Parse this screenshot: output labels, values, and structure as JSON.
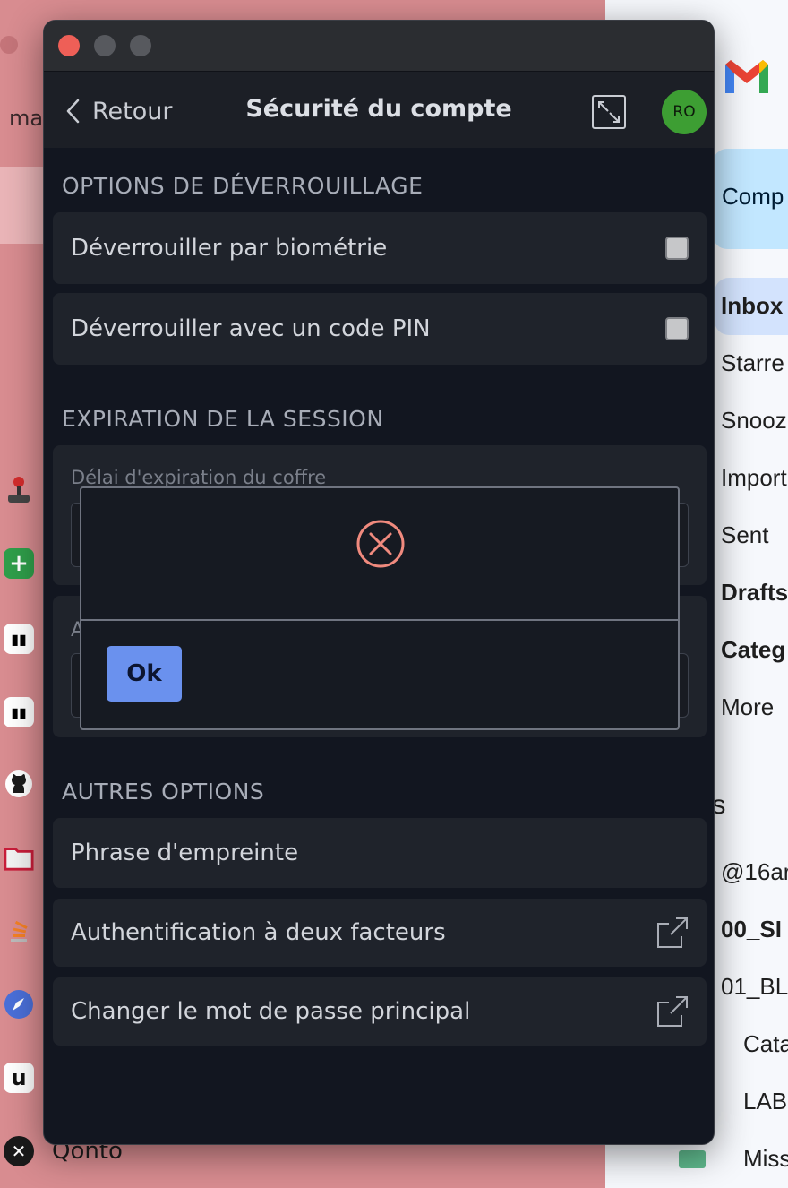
{
  "window": {
    "nav": {
      "back_label": "Retour",
      "title": "Sécurité du compte",
      "avatar_initials": "RO"
    },
    "sections": [
      {
        "heading": "OPTIONS DE DÉVERROUILLAGE",
        "items": [
          {
            "label": "Déverrouiller par biométrie",
            "control": "checkbox",
            "checked": false
          },
          {
            "label": "Déverrouiller avec un code PIN",
            "control": "checkbox",
            "checked": false
          }
        ]
      },
      {
        "heading": "EXPIRATION DE LA SESSION",
        "fields": [
          {
            "label": "Délai d'expiration du coffre",
            "value": ""
          },
          {
            "label": "A",
            "value": ""
          }
        ]
      },
      {
        "heading": "AUTRES OPTIONS",
        "items": [
          {
            "label": "Phrase d'empreinte",
            "control": "none"
          },
          {
            "label": "Authentification à deux facteurs",
            "control": "external-link-icon"
          },
          {
            "label": "Changer le mot de passe principal",
            "control": "external-link-icon"
          }
        ]
      }
    ],
    "dialog": {
      "icon": "error-circle-icon",
      "ok_label": "Ok"
    }
  },
  "background_left": {
    "partial_text": "ma",
    "dock_label": "Qonto"
  },
  "background_gmail": {
    "compose": "Comp",
    "nav": [
      {
        "label": "Inbox",
        "bold": true,
        "active": true
      },
      {
        "label": "Starre",
        "bold": false
      },
      {
        "label": "Snooz",
        "bold": false
      },
      {
        "label": "Import",
        "bold": false
      },
      {
        "label": "Sent",
        "bold": false
      },
      {
        "label": "Drafts",
        "bold": true
      },
      {
        "label": "Categ",
        "bold": true
      },
      {
        "label": "More",
        "bold": false
      }
    ],
    "labels_heading": "els",
    "labels": [
      {
        "label": "@16ar",
        "bold": false
      },
      {
        "label": "00_SI",
        "bold": true
      },
      {
        "label": "01_BL",
        "bold": false
      },
      {
        "label": "Cata",
        "bold": false
      },
      {
        "label": "LAB",
        "bold": false
      },
      {
        "label": "Miss",
        "bold": false
      }
    ]
  },
  "colors": {
    "accent_button": "#6a91ee",
    "error_icon": "#f08a7e",
    "avatar_bg": "#3d9e33",
    "traffic_close": "#ee5f57"
  }
}
